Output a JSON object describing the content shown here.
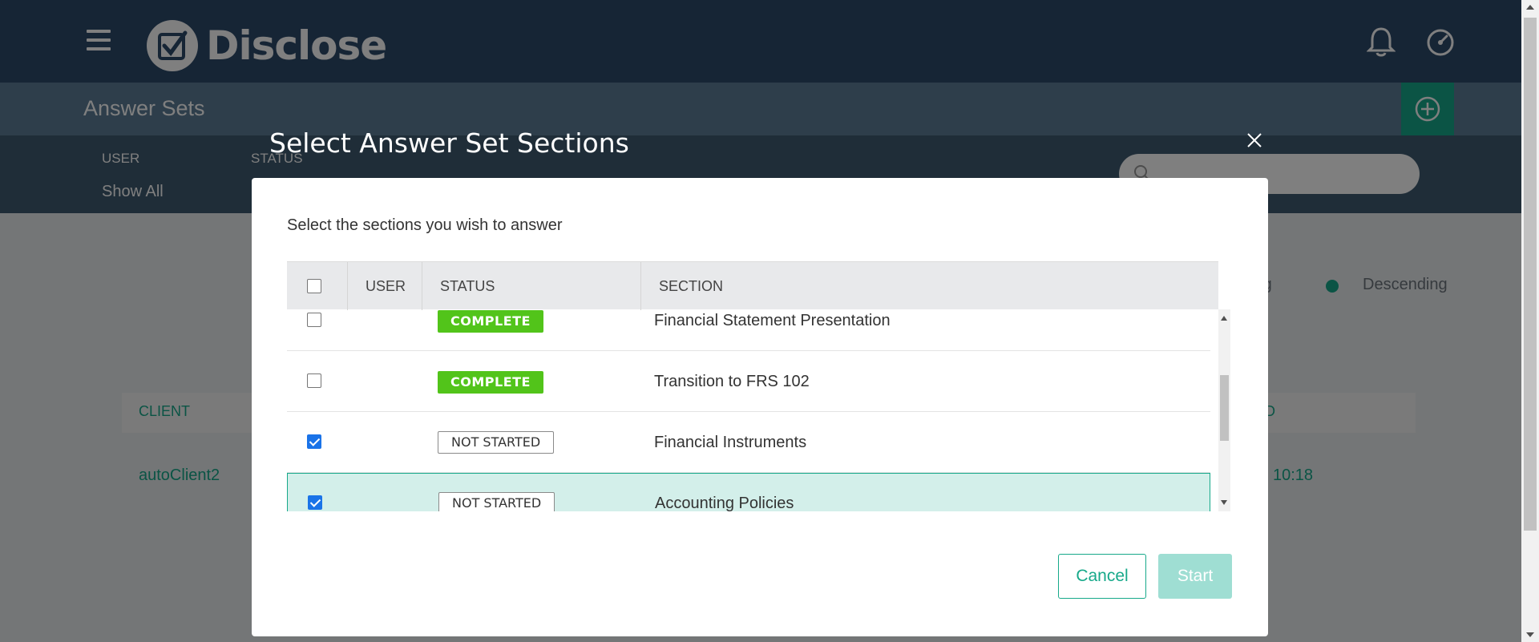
{
  "app": {
    "logo_text": "Disclose",
    "header_icons": [
      "bell-icon",
      "gauge-icon"
    ]
  },
  "page": {
    "title": "Answer Sets",
    "filters": {
      "user_label": "USER",
      "status_label": "STATUS",
      "show_all": "Show All"
    },
    "sort": {
      "ascending_partial": "ing",
      "descending": "Descending"
    },
    "list": {
      "client_header": "CLIENT",
      "right_header": "D",
      "rows": [
        {
          "client": "autoClient2",
          "time": "10:18"
        }
      ]
    }
  },
  "modal": {
    "title": "Select Answer Set Sections",
    "subtitle": "Select the sections you wish to answer",
    "columns": {
      "user": "USER",
      "status": "STATUS",
      "section": "SECTION"
    },
    "rows": [
      {
        "checked": false,
        "status": "COMPLETE",
        "status_type": "complete",
        "section": "Financial Statement Presentation"
      },
      {
        "checked": false,
        "status": "COMPLETE",
        "status_type": "complete",
        "section": "Transition to FRS 102"
      },
      {
        "checked": true,
        "status": "NOT STARTED",
        "status_type": "not-started",
        "section": "Financial Instruments"
      },
      {
        "checked": true,
        "status": "NOT STARTED",
        "status_type": "not-started",
        "section": "Accounting Policies",
        "selected": true
      }
    ],
    "buttons": {
      "cancel": "Cancel",
      "start": "Start"
    }
  },
  "colors": {
    "accent": "#17a98a",
    "header_bg": "#2d4a6b",
    "complete_badge": "#52c41a",
    "selected_row": "#d3efea",
    "checkbox_checked": "#1a73e8"
  }
}
